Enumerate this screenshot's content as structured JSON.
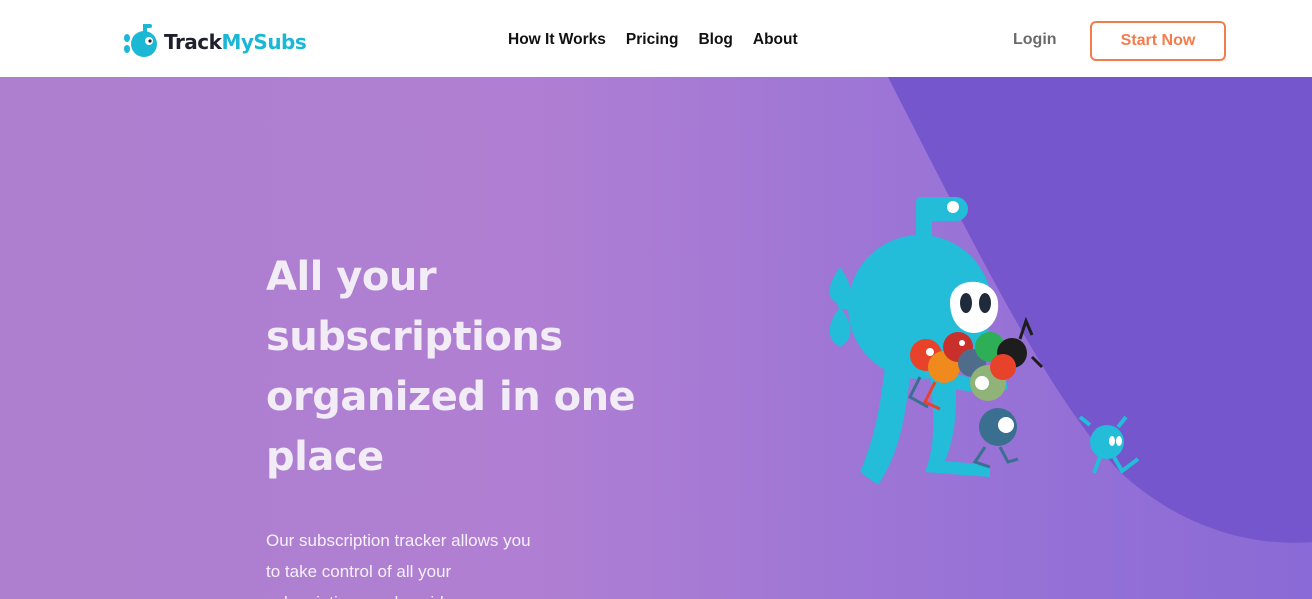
{
  "brand": {
    "name_part1": "Track",
    "name_part2": "MySubs"
  },
  "nav": {
    "items": [
      "How It Works",
      "Pricing",
      "Blog",
      "About"
    ]
  },
  "auth": {
    "login_label": "Login",
    "start_label": "Start Now"
  },
  "hero": {
    "headline": "All your subscriptions organized in one place",
    "description": "Our subscription tracker allows you to take control of all your subscriptions and avoid"
  },
  "colors": {
    "brand_cyan": "#1bb8d6",
    "accent_orange": "#f47c4c",
    "hero_purple": "#ad7fce",
    "deep_purple": "#7556cc"
  }
}
